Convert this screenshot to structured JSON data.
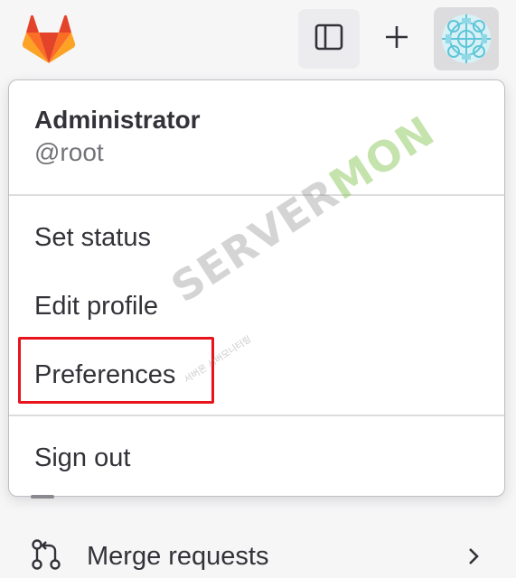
{
  "header": {
    "logo_icon": "gitlab-tanuki-icon",
    "sidebar_toggle_icon": "sidebar-toggle-icon",
    "new_icon": "plus-icon",
    "avatar_icon": "user-avatar-icon"
  },
  "user_menu": {
    "name": "Administrator",
    "username": "@root",
    "items": [
      {
        "label": "Set status"
      },
      {
        "label": "Edit profile"
      },
      {
        "label": "Preferences",
        "highlighted": true
      },
      {
        "label": "Sign out"
      }
    ]
  },
  "watermark": {
    "text_main": "SERVER",
    "text_accent": "MON",
    "sub": "서버몬 서버모니터링"
  },
  "sidebar": {
    "merge_requests_label": "Merge requests",
    "merge_requests_icon": "merge-request-icon",
    "chevron_icon": "chevron-right-icon"
  },
  "colors": {
    "highlight": "#e8141b",
    "gitlab_orange": "#fc6d26",
    "gitlab_red": "#e24329",
    "gitlab_light": "#fca326"
  }
}
